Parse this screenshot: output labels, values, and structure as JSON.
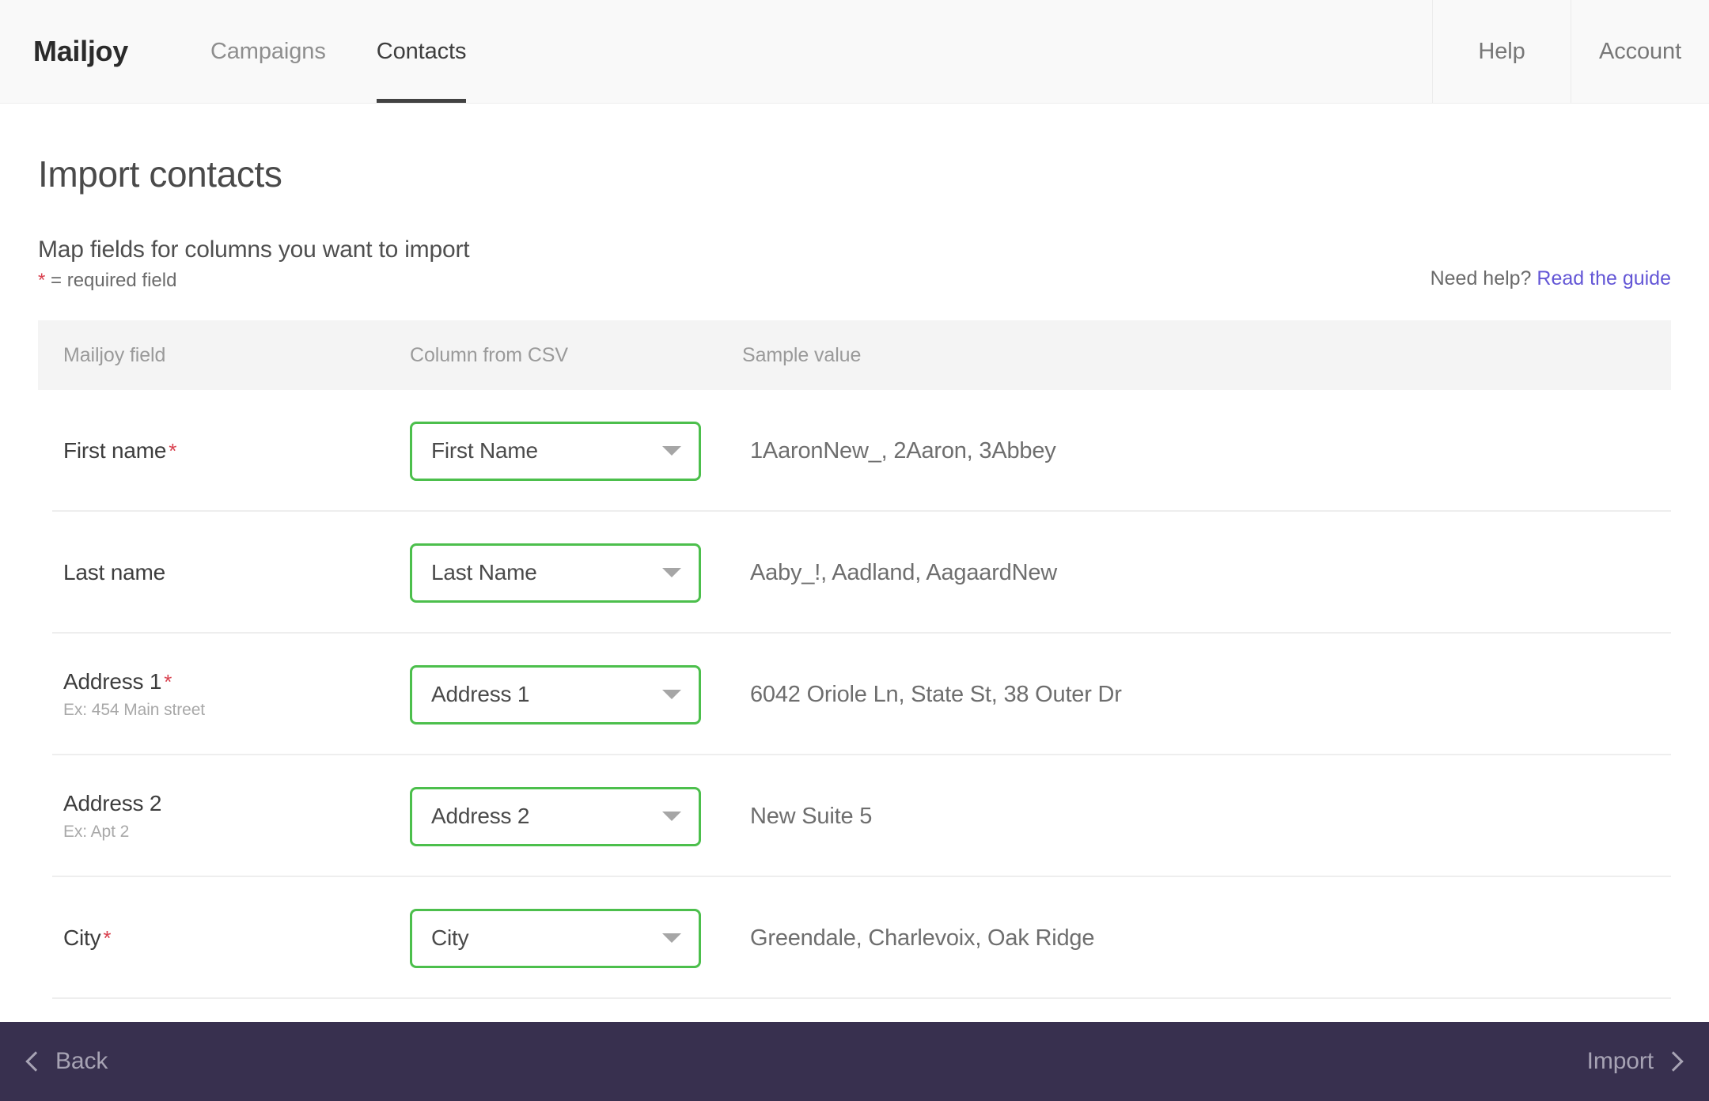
{
  "header": {
    "brand": "Mailjoy",
    "tabs": [
      {
        "label": "Campaigns",
        "active": false
      },
      {
        "label": "Contacts",
        "active": true
      }
    ],
    "right_items": [
      {
        "label": "Help"
      },
      {
        "label": "Account"
      }
    ]
  },
  "page": {
    "title": "Import contacts",
    "subhead": "Map fields for columns you want to import",
    "required_star": "*",
    "required_note": " = required field",
    "need_help_text": "Need help? ",
    "need_help_link": "Read the guide",
    "link_color": "#6356d6",
    "required_color": "#d9404e",
    "select_border_color": "#4cbf4c"
  },
  "table": {
    "columns": [
      "Mailjoy field",
      "Column from CSV",
      "Sample value"
    ],
    "rows": [
      {
        "field": "First name",
        "required": true,
        "hint": "",
        "selected": "First Name",
        "sample": "1AaronNew_, 2Aaron, 3Abbey"
      },
      {
        "field": "Last name",
        "required": false,
        "hint": "",
        "selected": "Last Name",
        "sample": "Aaby_!, Aadland, AagaardNew"
      },
      {
        "field": "Address 1",
        "required": true,
        "hint": "Ex: 454 Main street",
        "selected": "Address 1",
        "sample": "6042 Oriole Ln, State St, 38 Outer Dr"
      },
      {
        "field": "Address 2",
        "required": false,
        "hint": "Ex: Apt 2",
        "selected": "Address 2",
        "sample": "New Suite 5"
      },
      {
        "field": "City",
        "required": true,
        "hint": "",
        "selected": "City",
        "sample": "Greendale, Charlevoix, Oak Ridge"
      }
    ]
  },
  "footer": {
    "back_label": "Back",
    "import_label": "Import",
    "background": "#38304f"
  }
}
